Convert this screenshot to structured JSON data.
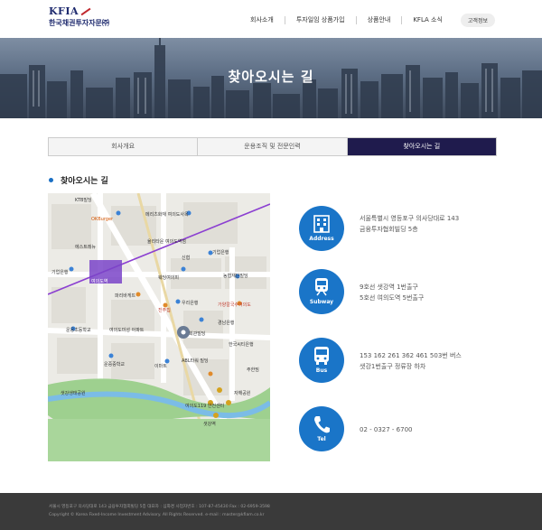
{
  "header": {
    "logo_en": "KFIA",
    "logo_ko": "한국채권투자자문㈜",
    "nav": [
      "회사소개",
      "투자일임 상품가입",
      "상품안내",
      "KFLA 소식"
    ],
    "customer_button": "고객정보"
  },
  "hero": {
    "title": "찾아오시는 길"
  },
  "tabs": [
    {
      "label": "회사개요"
    },
    {
      "label": "운용조직 및 전문인력"
    },
    {
      "label": "찾아오시는 길"
    }
  ],
  "active_tab": 2,
  "section": {
    "title": "찾아오시는 길"
  },
  "map": {
    "labels": [
      "KTB빌딩",
      "OKBurger",
      "메리츠화재 여의도사옥",
      "에스트레뉴",
      "율리타운 여의도역점",
      "기업은행",
      "여의도역",
      "신협",
      "기업은행",
      "웨딩여의피",
      "파리바게뜨",
      "농협재단빌딩",
      "우리은행",
      "진주집",
      "가양칼국수여의도",
      "운웅초등학교",
      "여의도미성 아파트",
      "경남은행",
      "회관빌딩",
      "한국씨티은행",
      "운중중학교",
      "이마트",
      "ABL타워 빌딩",
      "여의도119 안전센터",
      "주한밈",
      "샛강생태공원",
      "자해공원",
      "샛강역"
    ]
  },
  "info": [
    {
      "icon": "building-icon",
      "caption": "Address",
      "lines": [
        "서울특별시 영등포구 의사당대로 143",
        "금융투자협회빌딩 5층"
      ]
    },
    {
      "icon": "subway-icon",
      "caption": "Subway",
      "lines": [
        "9호선 샛강역 1번출구",
        "5호선 여의도역 5번출구"
      ]
    },
    {
      "icon": "bus-icon",
      "caption": "Bus",
      "lines": [
        "153 162 261 362 461 503번 버스",
        "샛강1번출구 정류장 하차"
      ]
    },
    {
      "icon": "phone-icon",
      "caption": "Tel",
      "lines": [
        "02 - 0327 - 6700"
      ]
    }
  ],
  "footer": {
    "line1": "서울시 영등포구 의사당대로 143 금융투자협회빌딩 5층 대표자 : 심화경 사업자번호 : 107-87-45430 Fax : 02-6959-3598",
    "line2": "Copyright © Korea Fixed-Income Investment Advisory. All Rights Reserved. e-mail : master@kfiam.co.kr"
  },
  "colors": {
    "accent": "#1a75c8",
    "tab_active": "#1f1b4d",
    "footer_bg": "#3a3a3a",
    "brand": "#1e2a6e"
  }
}
